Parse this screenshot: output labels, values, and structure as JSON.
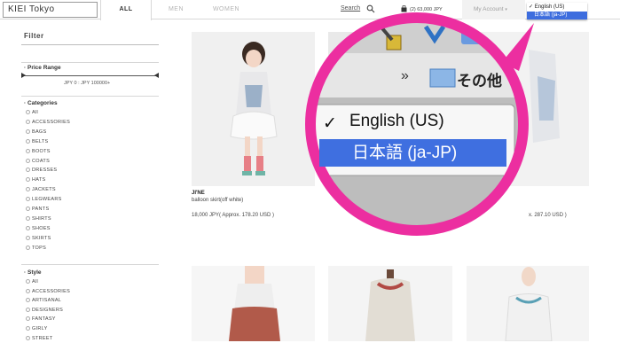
{
  "header": {
    "logo": "KIEI Tokyo",
    "tabs": [
      "ALL",
      "MEN",
      "WOMEN"
    ],
    "search_label": "Search",
    "cart_label": "(2) 63,000 JPY",
    "account_label": "My Account",
    "language_menu": {
      "selected_check": "✓",
      "selected_label": "English (US)",
      "highlighted_label": "日本語 (ja-JP)"
    }
  },
  "sidebar": {
    "title": "Filter",
    "price_range": {
      "title": "Price Range",
      "range_text": "JPY 0 : JPY 100000+"
    },
    "categories": {
      "title": "Categories",
      "items": [
        "All",
        "ACCESSORIES",
        "BAGS",
        "BELTS",
        "BOOTS",
        "COATS",
        "DRESSES",
        "HATS",
        "JACKETS",
        "LEGWEARS",
        "PANTS",
        "SHIRTS",
        "SHOES",
        "SKIRTS",
        "TOPS"
      ]
    },
    "style": {
      "title": "Style",
      "items": [
        "All",
        "ACCESSORIES",
        "ARTISANAL",
        "DESIGNERS",
        "FANTASY",
        "GIRLY",
        "STREET"
      ]
    }
  },
  "products": [
    {
      "brand": "JI'NE",
      "name": "balloon skirt(off white)",
      "price": "18,000 JPY( Approx. 178.20 USD )"
    },
    {
      "price_partial": "x. 287.10 USD )"
    }
  ],
  "zoom": {
    "check": "✓",
    "english_label": "English (US)",
    "japanese_label": "日本語 (ja-JP)",
    "chevron": "»",
    "folder_label": "その他"
  },
  "colors": {
    "highlight": "#3d6dde",
    "magnifier_ring": "#ec2ea0"
  }
}
